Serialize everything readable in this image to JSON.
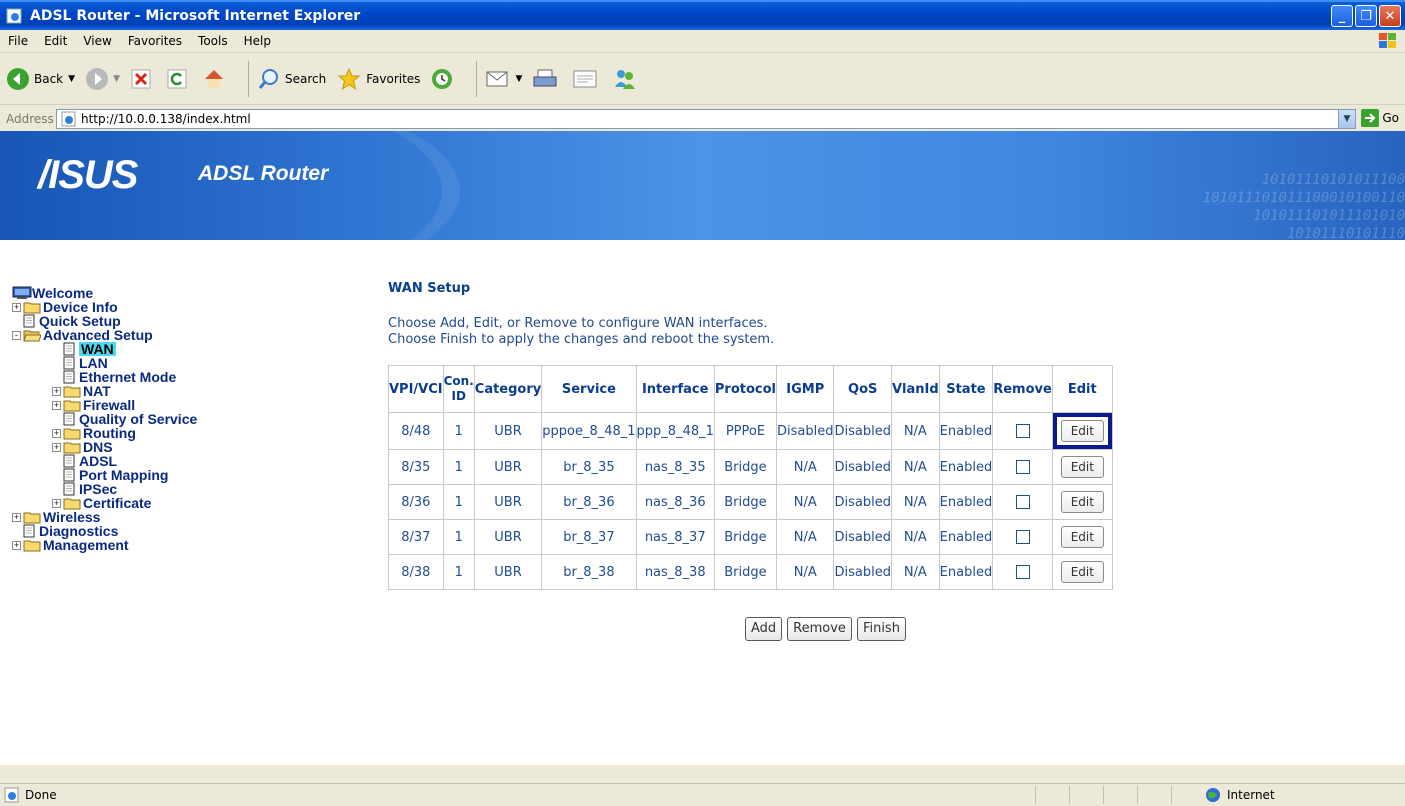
{
  "window": {
    "title": "ADSL Router - Microsoft Internet Explorer"
  },
  "menu": [
    "File",
    "Edit",
    "View",
    "Favorites",
    "Tools",
    "Help"
  ],
  "toolbar": {
    "back": "Back",
    "search": "Search",
    "favorites": "Favorites"
  },
  "address": {
    "label": "Address",
    "url": "http://10.0.0.138/index.html",
    "go": "Go"
  },
  "banner": {
    "logo": "/ISUS",
    "subtitle": "ADSL Router",
    "binary": "10101110101011100\n101011101011100010100110\n101011101011101010\n10101110101110"
  },
  "nav": [
    {
      "label": "Welcome",
      "indent": 0,
      "kind": "root"
    },
    {
      "label": "Device Info",
      "indent": 0,
      "kind": "folder",
      "exp": "+"
    },
    {
      "label": "Quick Setup",
      "indent": 0,
      "kind": "doc"
    },
    {
      "label": "Advanced Setup",
      "indent": 0,
      "kind": "folder-open",
      "exp": "-"
    },
    {
      "label": "WAN",
      "indent": 1,
      "kind": "doc",
      "selected": true
    },
    {
      "label": "LAN",
      "indent": 1,
      "kind": "doc"
    },
    {
      "label": "Ethernet Mode",
      "indent": 1,
      "kind": "doc"
    },
    {
      "label": "NAT",
      "indent": 1,
      "kind": "folder",
      "exp": "+"
    },
    {
      "label": "Firewall",
      "indent": 1,
      "kind": "folder",
      "exp": "+"
    },
    {
      "label": "Quality of Service",
      "indent": 1,
      "kind": "doc"
    },
    {
      "label": "Routing",
      "indent": 1,
      "kind": "folder",
      "exp": "+"
    },
    {
      "label": "DNS",
      "indent": 1,
      "kind": "folder",
      "exp": "+"
    },
    {
      "label": "ADSL",
      "indent": 1,
      "kind": "doc"
    },
    {
      "label": "Port Mapping",
      "indent": 1,
      "kind": "doc"
    },
    {
      "label": "IPSec",
      "indent": 1,
      "kind": "doc"
    },
    {
      "label": "Certificate",
      "indent": 1,
      "kind": "folder",
      "exp": "+"
    },
    {
      "label": "Wireless",
      "indent": 0,
      "kind": "folder",
      "exp": "+"
    },
    {
      "label": "Diagnostics",
      "indent": 0,
      "kind": "doc"
    },
    {
      "label": "Management",
      "indent": 0,
      "kind": "folder",
      "exp": "+"
    }
  ],
  "main": {
    "title": "WAN Setup",
    "desc_line1": "Choose Add, Edit, or Remove to configure WAN interfaces.",
    "desc_line2": "Choose Finish to apply the changes and reboot the system."
  },
  "table": {
    "headers": [
      "VPI/VCI",
      "Con. ID",
      "Category",
      "Service",
      "Interface",
      "Protocol",
      "IGMP",
      "QoS",
      "VlanId",
      "State",
      "Remove",
      "Edit"
    ],
    "rows": [
      [
        "8/48",
        "1",
        "UBR",
        "pppoe_8_48_1",
        "ppp_8_48_1",
        "PPPoE",
        "Disabled",
        "Disabled",
        "N/A",
        "Enabled"
      ],
      [
        "8/35",
        "1",
        "UBR",
        "br_8_35",
        "nas_8_35",
        "Bridge",
        "N/A",
        "Disabled",
        "N/A",
        "Enabled"
      ],
      [
        "8/36",
        "1",
        "UBR",
        "br_8_36",
        "nas_8_36",
        "Bridge",
        "N/A",
        "Disabled",
        "N/A",
        "Enabled"
      ],
      [
        "8/37",
        "1",
        "UBR",
        "br_8_37",
        "nas_8_37",
        "Bridge",
        "N/A",
        "Disabled",
        "N/A",
        "Enabled"
      ],
      [
        "8/38",
        "1",
        "UBR",
        "br_8_38",
        "nas_8_38",
        "Bridge",
        "N/A",
        "Disabled",
        "N/A",
        "Enabled"
      ]
    ],
    "edit_label": "Edit"
  },
  "actions": {
    "add": "Add",
    "remove": "Remove",
    "finish": "Finish"
  },
  "status": {
    "left": "Done",
    "zone": "Internet"
  }
}
